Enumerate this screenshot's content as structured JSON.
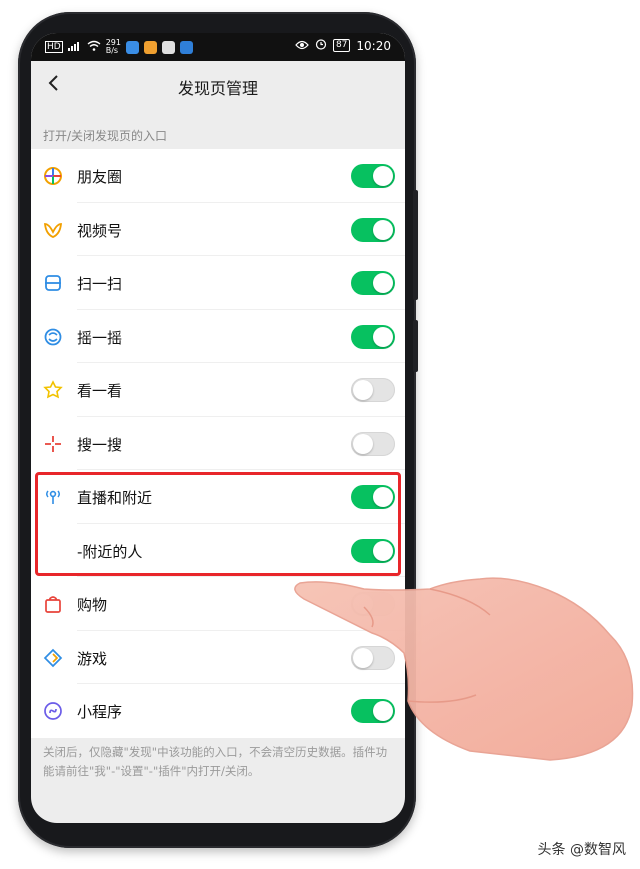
{
  "status_bar": {
    "carrier_left": "HD",
    "net_speed": "291",
    "net_unit": "B/s",
    "battery": "87",
    "time": "10:20"
  },
  "nav": {
    "title": "发现页管理",
    "back_icon": "chevron-left-icon"
  },
  "section_title": "打开/关闭发现页的入口",
  "items": [
    {
      "label": "朋友圈",
      "icon": "moments-icon",
      "on": true
    },
    {
      "label": "视频号",
      "icon": "channels-icon",
      "on": true
    },
    {
      "label": "扫一扫",
      "icon": "scan-icon",
      "on": true
    },
    {
      "label": "摇一摇",
      "icon": "shake-icon",
      "on": true
    },
    {
      "label": "看一看",
      "icon": "top-stories-icon",
      "on": false
    },
    {
      "label": "搜一搜",
      "icon": "search-icon",
      "on": false
    },
    {
      "label": "直播和附近",
      "icon": "live-nearby-icon",
      "on": true
    },
    {
      "label": "-附近的人",
      "icon": "",
      "on": true
    },
    {
      "label": "购物",
      "icon": "shopping-icon",
      "on": false
    },
    {
      "label": "游戏",
      "icon": "games-icon",
      "on": false
    },
    {
      "label": "小程序",
      "icon": "mini-programs-icon",
      "on": true
    }
  ],
  "footer_note": "关闭后，仅隐藏\"发现\"中该功能的入口，不会清空历史数据。插件功能请前往\"我\"-\"设置\"-\"插件\"内打开/关闭。",
  "watermark": "头条 @数智风",
  "colors": {
    "toggle_on": "#07c160",
    "highlight": "#e8262a"
  }
}
